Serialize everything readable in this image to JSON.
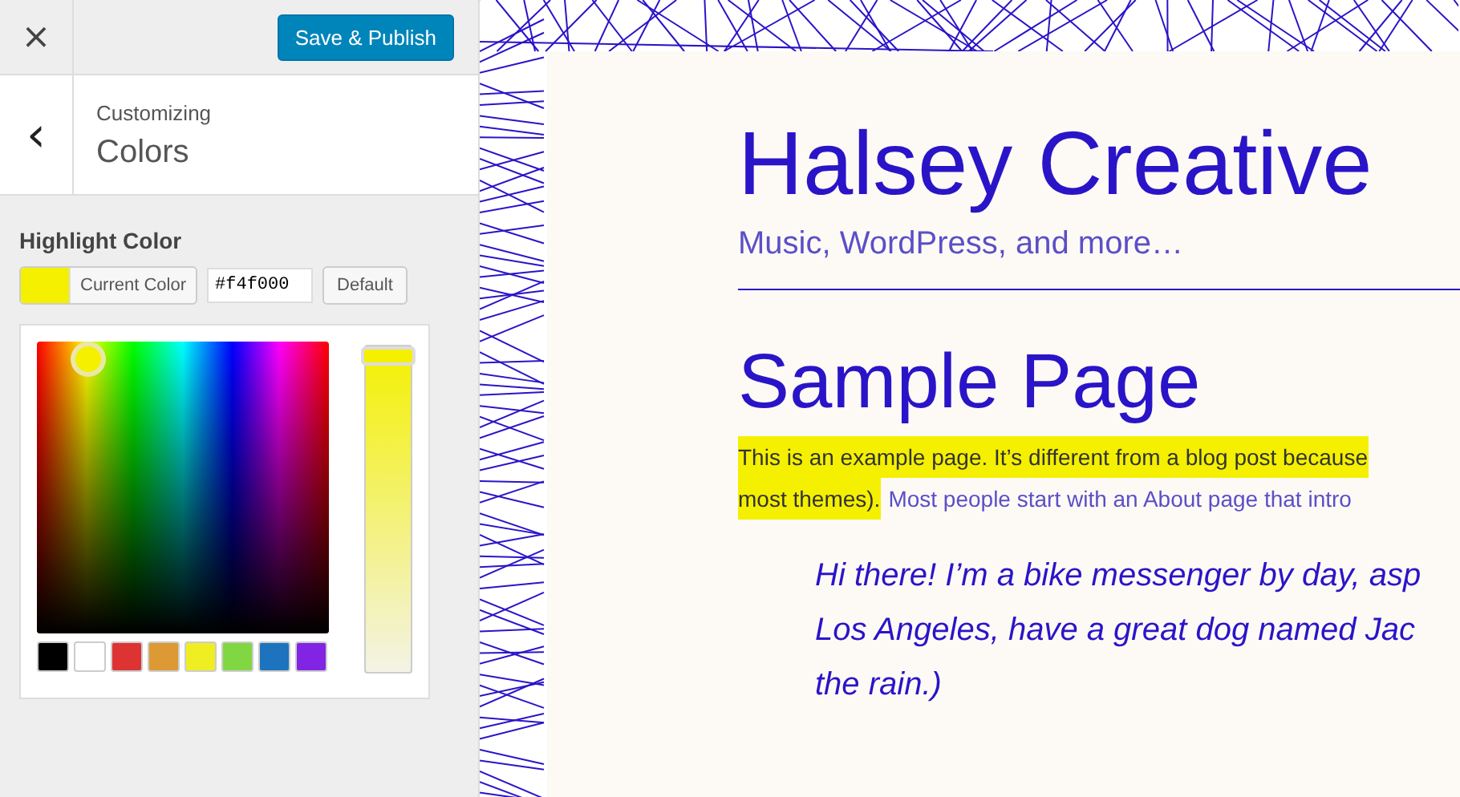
{
  "header": {
    "close_icon": "×",
    "publish_button": "Save & Publish"
  },
  "section": {
    "back_icon": "‹",
    "breadcrumb": "Customizing",
    "title": "Colors"
  },
  "highlight_color": {
    "label": "Highlight Color",
    "current_button": "Current Color",
    "value": "#f4f000",
    "default_button": "Default",
    "slider": {
      "level": 1
    },
    "swatches": [
      {
        "color": "#000000"
      },
      {
        "color": "#ffffff"
      },
      {
        "color": "#dd3333"
      },
      {
        "color": "#dd9933"
      },
      {
        "color": "#eeee22"
      },
      {
        "color": "#81d742"
      },
      {
        "color": "#1e73be"
      },
      {
        "color": "#8224e3"
      }
    ]
  },
  "preview": {
    "site_title": "Halsey Creative",
    "tagline": "Music, WordPress, and more…",
    "page_title": "Sample Page",
    "paragraph_lines": [
      [
        {
          "text": "This is an example page. It’s different from a blog post because",
          "highlighted": true
        }
      ],
      [
        {
          "text": "most themes).",
          "highlighted": true
        },
        {
          "text": "Most people start with an About page that intro",
          "highlighted": false
        }
      ]
    ],
    "quote_lines": [
      "Hi there! I’m a bike messenger by day, asp",
      "Los Angeles, have a great dog named Jac",
      "the rain.)"
    ]
  }
}
